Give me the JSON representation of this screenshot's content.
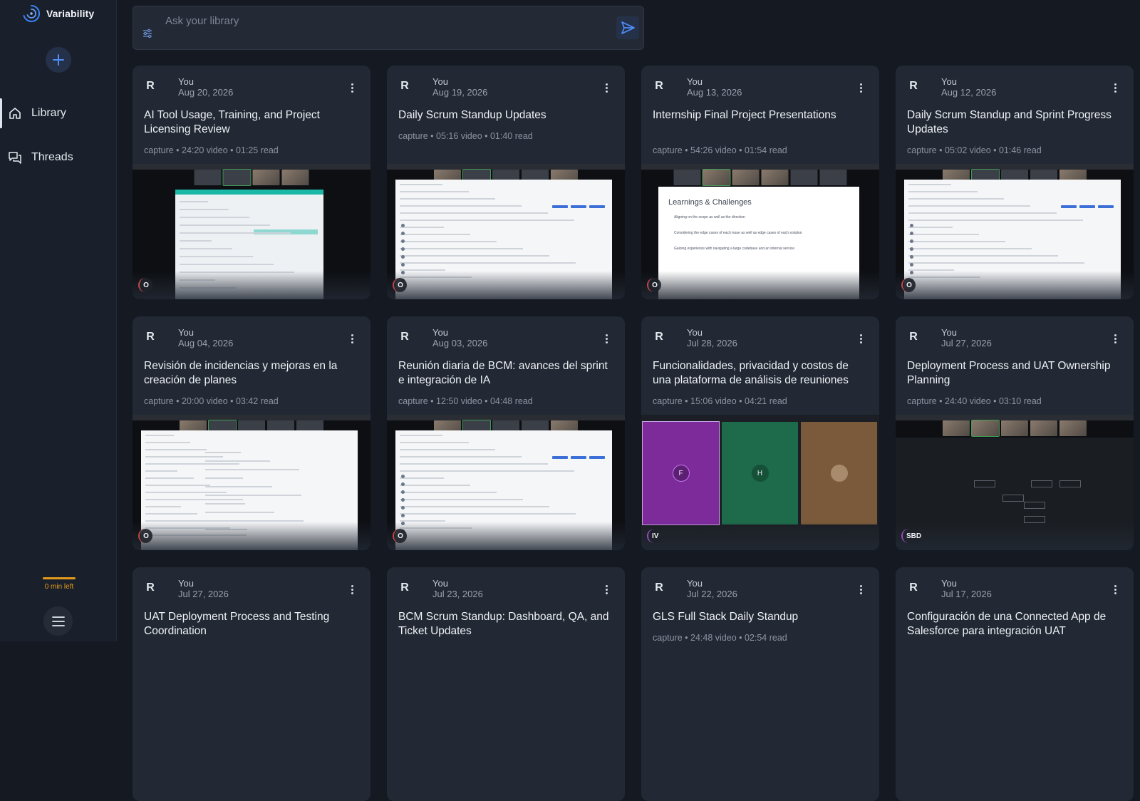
{
  "app": {
    "name": "Variability",
    "new_label": "+",
    "nav": [
      {
        "label": "Library",
        "icon": "home-icon",
        "active": true
      },
      {
        "label": "Threads",
        "icon": "threads-icon",
        "active": false
      }
    ],
    "credits_text": "0 min left"
  },
  "search": {
    "placeholder": "Ask your library"
  },
  "cards": [
    {
      "avatar": "R",
      "owner": "You",
      "date": "Aug 20, 2026",
      "title": "AI Tool Usage, Training, and Project Licensing Review",
      "meta": "capture • 24:20 video • 01:25 read",
      "initials": "O",
      "thumb": "dashboard"
    },
    {
      "avatar": "R",
      "owner": "You",
      "date": "Aug 19, 2026",
      "title": "Daily Scrum Standup Updates",
      "meta": "capture • 05:16 video • 01:40 read",
      "initials": "O",
      "thumb": "board"
    },
    {
      "avatar": "R",
      "owner": "You",
      "date": "Aug 13, 2026",
      "title": "Internship Final Project Presentations",
      "meta": "capture • 54:26 video • 01:54 read",
      "initials": "O",
      "thumb": "slide",
      "slide": {
        "title": "Learnings & Challenges",
        "lines": [
          "Aligning on the scope as well as the direction",
          "Considering the edge cases of each issue as well as edge cases of each solution",
          "Gaining experience with navigating a large codebase and an internal service"
        ]
      }
    },
    {
      "avatar": "R",
      "owner": "You",
      "date": "Aug 12, 2026",
      "title": "Daily Scrum Standup and Sprint Progress Updates",
      "meta": "capture • 05:02 video • 01:46 read",
      "initials": "O",
      "thumb": "board"
    },
    {
      "avatar": "R",
      "owner": "You",
      "date": "Aug 04, 2026",
      "title": "Revisión de incidencias y mejoras en la creación de planes",
      "meta": "capture • 20:00 video • 03:42 read",
      "initials": "O",
      "thumb": "doc"
    },
    {
      "avatar": "R",
      "owner": "You",
      "date": "Aug 03, 2026",
      "title": "Reunión diaria de BCM: avances del sprint e integración de IA",
      "meta": "capture • 12:50 video • 04:48 read",
      "initials": "O",
      "thumb": "board"
    },
    {
      "avatar": "R",
      "owner": "You",
      "date": "Jul 28, 2026",
      "title": "Funcionalidades, privacidad y costos de una plataforma de análisis de reuniones",
      "meta": "capture • 15:06 video • 04:21 read",
      "initials": "IV",
      "thumb": "call",
      "call": {
        "p1": "F",
        "p2": "H"
      }
    },
    {
      "avatar": "R",
      "owner": "You",
      "date": "Jul 27, 2026",
      "title": "Deployment Process and UAT Ownership Planning",
      "meta": "capture • 24:40 video • 03:10 read",
      "initials": "SBD",
      "thumb": "diagram"
    },
    {
      "avatar": "R",
      "owner": "You",
      "date": "Jul 27, 2026",
      "title": "UAT Deployment Process and Testing Coordination",
      "meta": "",
      "initials": "",
      "thumb": ""
    },
    {
      "avatar": "R",
      "owner": "You",
      "date": "Jul 23, 2026",
      "title": "BCM Scrum Standup: Dashboard, QA, and Ticket Updates",
      "meta": "",
      "initials": "",
      "thumb": ""
    },
    {
      "avatar": "R",
      "owner": "You",
      "date": "Jul 22, 2026",
      "title": "GLS Full Stack Daily Standup",
      "meta": "capture • 24:48 video • 02:54 read",
      "initials": "",
      "thumb": ""
    },
    {
      "avatar": "R",
      "owner": "You",
      "date": "Jul 17, 2026",
      "title": "Configuración de una Connected App de Salesforce para integración UAT",
      "meta": "",
      "initials": "",
      "thumb": ""
    }
  ],
  "colors": {
    "background": "#141922",
    "card": "#222934",
    "accent": "#3b82f6",
    "credits": "#e39a1c"
  }
}
